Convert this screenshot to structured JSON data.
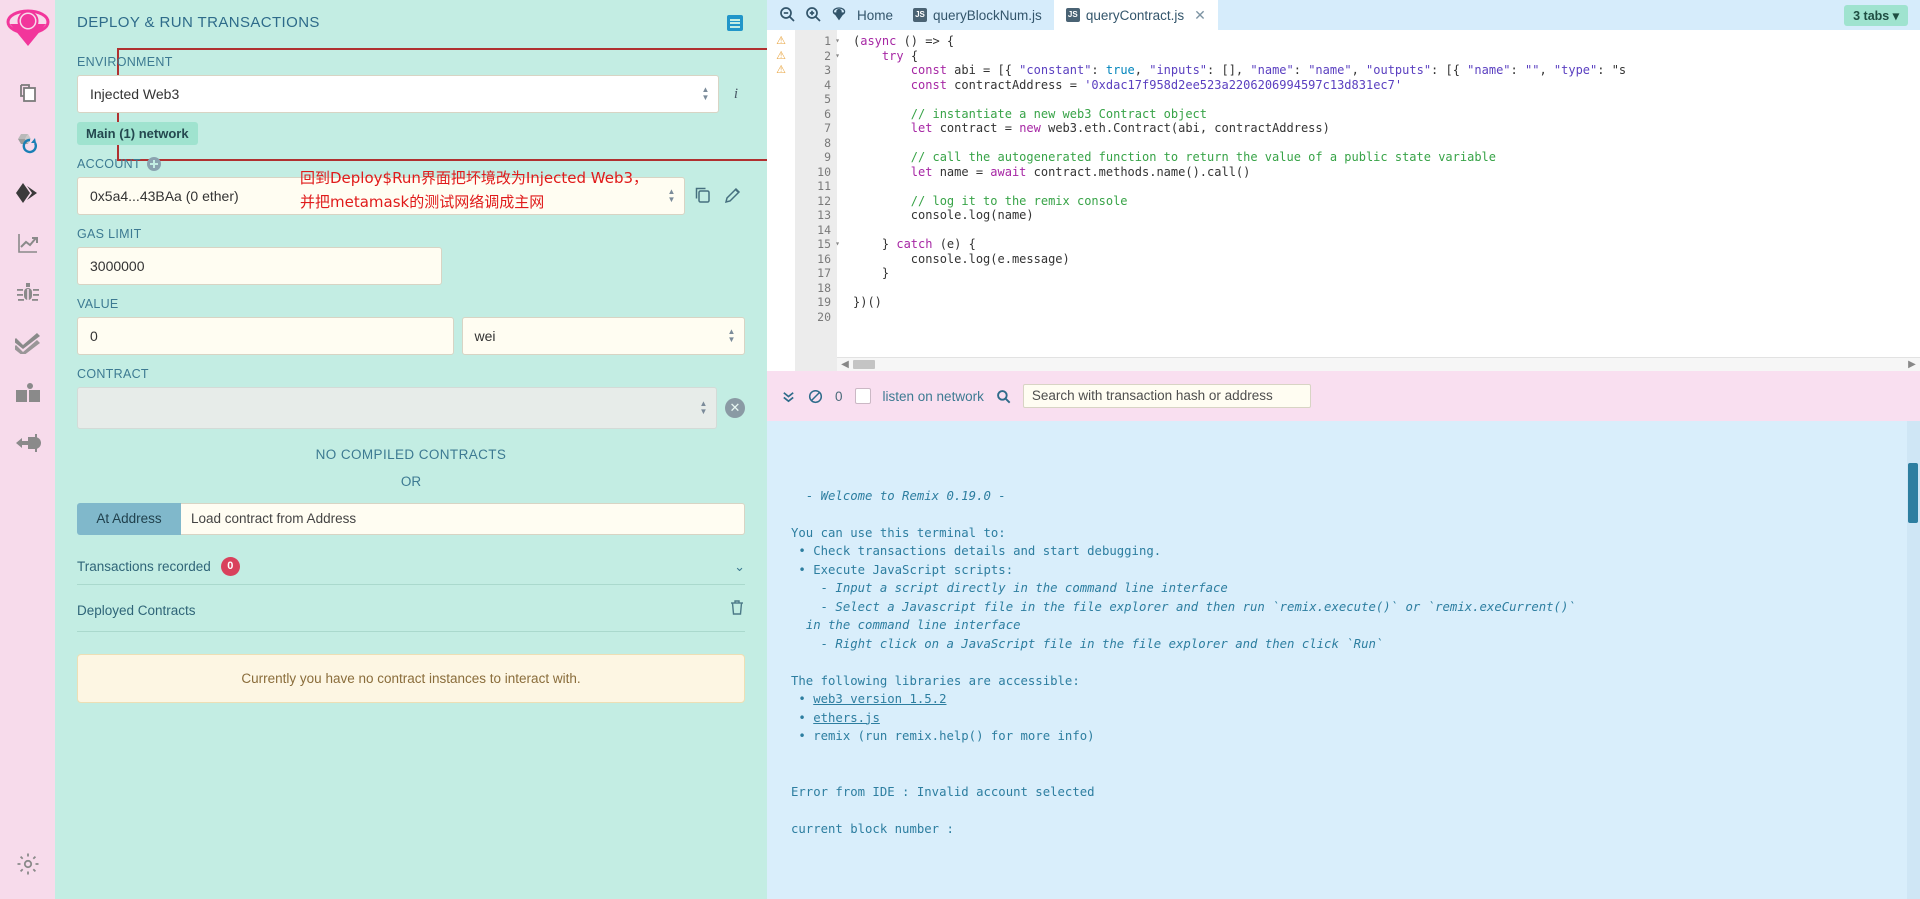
{
  "iconbar": {
    "items": [
      {
        "name": "remix-logo",
        "title": "Remix"
      },
      {
        "name": "file-explorers-icon",
        "title": "File explorers"
      },
      {
        "name": "solidity-compiler-icon",
        "title": "Solidity compiler"
      },
      {
        "name": "deploy-run-transactions-icon",
        "title": "Deploy & run transactions"
      },
      {
        "name": "solidity-analyzers-icon",
        "title": "Solidity analyzers"
      },
      {
        "name": "debugger-icon",
        "title": "Debugger"
      },
      {
        "name": "unit-testing-icon",
        "title": "Solidity unit testing"
      },
      {
        "name": "documentation-icon",
        "title": "Documentation"
      },
      {
        "name": "plugin-manager-icon",
        "title": "Plugin manager"
      },
      {
        "name": "settings-icon",
        "title": "Settings"
      }
    ]
  },
  "left_panel": {
    "title": "DEPLOY & RUN TRANSACTIONS",
    "environment": {
      "label": "ENVIRONMENT",
      "value": "Injected Web3",
      "network_badge": "Main (1) network",
      "info_glyph": "i"
    },
    "account": {
      "label": "ACCOUNT",
      "value": "0x5a4...43BAa (0 ether)"
    },
    "gas_limit": {
      "label": "GAS LIMIT",
      "value": "3000000"
    },
    "value_field": {
      "label": "VALUE",
      "value": "0",
      "unit": "wei"
    },
    "contract": {
      "label": "CONTRACT",
      "value": "",
      "no_compiled": "NO COMPILED CONTRACTS",
      "or": "OR"
    },
    "at_address": {
      "button": "At Address",
      "placeholder": "Load contract from Address"
    },
    "transactions_recorded": {
      "label": "Transactions recorded",
      "count": "0"
    },
    "deployed_contracts": {
      "label": "Deployed Contracts",
      "empty_message": "Currently you have no contract instances to interact with."
    },
    "annotation": "回到Deploy$Run界面把坏境改为Injected Web3，\n并把metamask的测试网络调成主网"
  },
  "tabbar": {
    "home_label": "Home",
    "tabs": [
      {
        "label": "queryBlockNum.js",
        "type": "JS",
        "active": false,
        "closable": false
      },
      {
        "label": "queryContract.js",
        "type": "JS",
        "active": true,
        "closable": true
      }
    ],
    "tabs_badge": "3 tabs",
    "zoom_out_icon": "zoom-out-icon",
    "zoom_in_icon": "zoom-in-icon"
  },
  "editor": {
    "warnings": [
      "⚠",
      "⚠",
      "⚠"
    ],
    "line_numbers": [
      "1",
      "2",
      "3",
      "4",
      "5",
      "6",
      "7",
      "8",
      "9",
      "10",
      "11",
      "12",
      "13",
      "14",
      "15",
      "16",
      "17",
      "18",
      "19",
      "20"
    ],
    "folds": [
      1,
      2,
      15
    ],
    "lines": [
      "(async () => {",
      "    try {",
      "        const abi = [{ \"constant\": true, \"inputs\": [], \"name\": \"name\", \"outputs\": [{ \"name\": \"\", \"type\": \"s",
      "        const contractAddress = '0xdac17f958d2ee523a2206206994597c13d831ec7'",
      "",
      "        // instantiate a new web3 Contract object",
      "        let contract = new web3.eth.Contract(abi, contractAddress)",
      "",
      "        // call the autogenerated function to return the value of a public state variable",
      "        let name = await contract.methods.name().call()",
      "",
      "        // log it to the remix console",
      "        console.log(name)",
      "",
      "    } catch (e) {",
      "        console.log(e.message)",
      "    }",
      "",
      "})()",
      ""
    ]
  },
  "terminal_bar": {
    "chevrons_icon": "double-chevron-down-icon",
    "block_icon": "no-entry-icon",
    "count": "0",
    "listen_label": "listen on network",
    "search_icon": "search-icon",
    "search_placeholder": "Search with transaction hash or address"
  },
  "terminal": {
    "lines": [
      "  - Welcome to Remix 0.19.0 -",
      "",
      "You can use this terminal to:",
      " • Check transactions details and start debugging.",
      " • Execute JavaScript scripts:",
      "    - Input a script directly in the command line interface",
      "    - Select a Javascript file in the file explorer and then run `remix.execute()` or `remix.exeCurrent()`",
      "  in the command line interface",
      "    - Right click on a JavaScript file in the file explorer and then click `Run`",
      "",
      "The following libraries are accessible:",
      " • web3 version 1.5.2",
      " • ethers.js",
      " • remix (run remix.help() for more info)",
      "",
      "",
      "Error from IDE : Invalid account selected",
      "",
      "current block number :"
    ]
  },
  "colors": {
    "panel_bg": "#c3ede3",
    "iconbar_bg": "#f7dbeb",
    "accent": "#2d7ea0",
    "annotation_red": "#e01b1b",
    "badge_green": "#9fe3cf",
    "terminal_bg": "#d9eefb"
  }
}
